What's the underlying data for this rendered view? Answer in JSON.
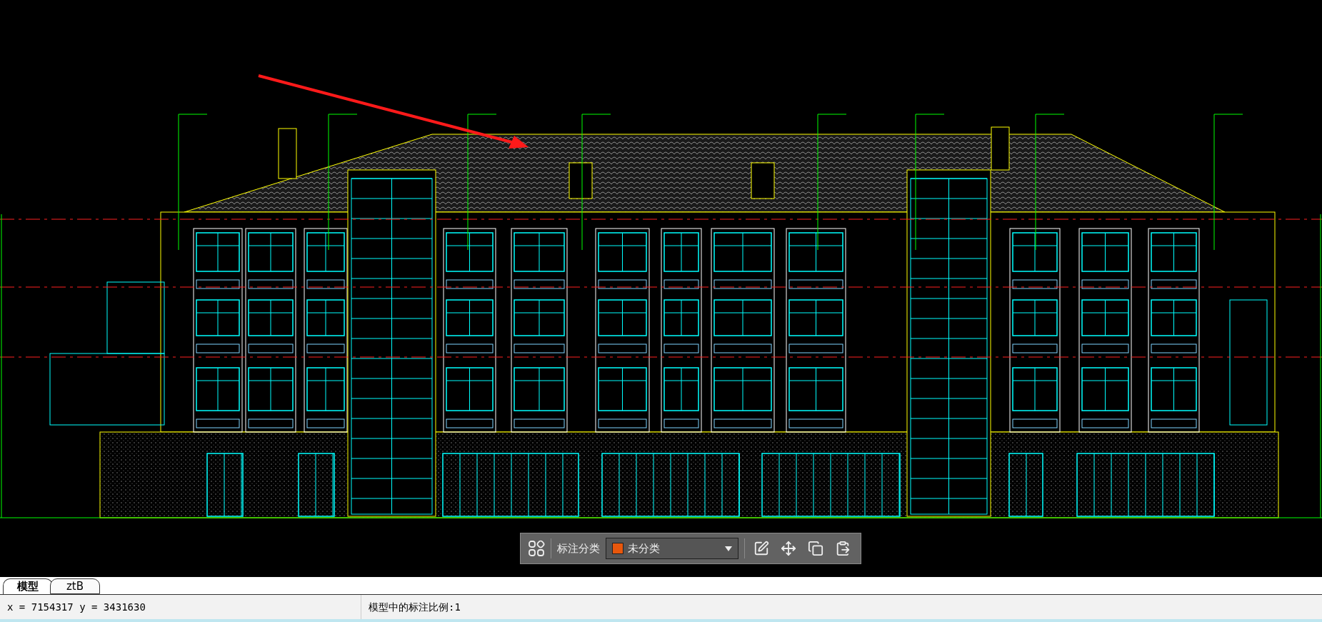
{
  "toolbar": {
    "label": "标注分类",
    "dropdown": {
      "value": "未分类",
      "color": "#e8570c"
    }
  },
  "tabs": [
    {
      "label": "模型",
      "selected": true
    },
    {
      "label": "ztB",
      "selected": false
    }
  ],
  "status_bar": {
    "coordinates": "x = 7154317 y = 3431630",
    "scale": "模型中的标注比例:1"
  }
}
